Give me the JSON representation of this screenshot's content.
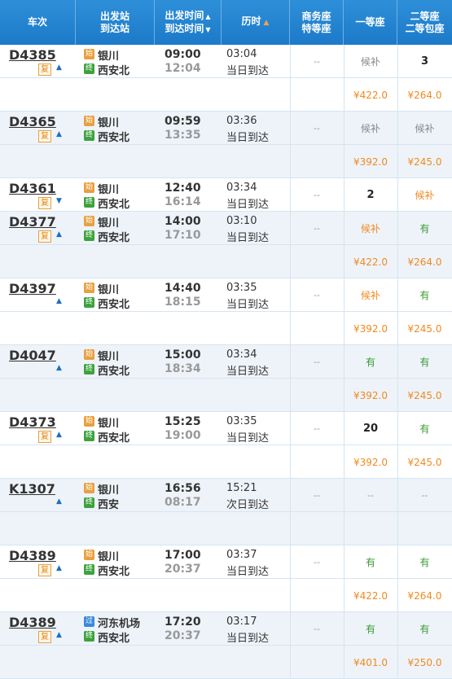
{
  "header": {
    "train": "车次",
    "from_station": "出发站",
    "to_station": "到达站",
    "dep_time": "出发时间",
    "arr_time": "到达时间",
    "duration": "历时",
    "business_1": "商务座",
    "business_2": "特等座",
    "first": "一等座",
    "second_1": "二等座",
    "second_2": "二等包座"
  },
  "trains": [
    {
      "no": "D4385",
      "fu": "复",
      "dir": "up",
      "from_badge": "始",
      "from": "银川",
      "to_badge": "终",
      "to": "西安北",
      "dep": "09:00",
      "arr": "12:04",
      "dur": "03:04",
      "day": "当日到达",
      "business": "--",
      "first": "候补",
      "first_c": "gray",
      "second": "3",
      "second_c": "num",
      "price_first": "¥422.0",
      "price_second": "¥264.0"
    },
    {
      "no": "D4365",
      "fu": "复",
      "dir": "up",
      "from_badge": "始",
      "from": "银川",
      "to_badge": "终",
      "to": "西安北",
      "dep": "09:59",
      "arr": "13:35",
      "dur": "03:36",
      "day": "当日到达",
      "business": "--",
      "first": "候补",
      "first_c": "gray",
      "second": "候补",
      "second_c": "gray",
      "price_first": "¥392.0",
      "price_second": "¥245.0"
    },
    {
      "no": "D4361",
      "fu": "复",
      "dir": "down",
      "from_badge": "始",
      "from": "银川",
      "to_badge": "终",
      "to": "西安北",
      "dep": "12:40",
      "arr": "16:14",
      "dur": "03:34",
      "day": "当日到达",
      "business": "--",
      "first": "2",
      "first_c": "num",
      "second": "候补",
      "second_c": "orange",
      "price_first": "",
      "price_second": ""
    },
    {
      "no": "D4377",
      "fu": "复",
      "dir": "up",
      "from_badge": "始",
      "from": "银川",
      "to_badge": "终",
      "to": "西安北",
      "dep": "14:00",
      "arr": "17:10",
      "dur": "03:10",
      "day": "当日到达",
      "business": "--",
      "first": "候补",
      "first_c": "orange",
      "second": "有",
      "second_c": "green",
      "price_first": "¥422.0",
      "price_second": "¥264.0"
    },
    {
      "no": "D4397",
      "fu": "",
      "dir": "up",
      "from_badge": "始",
      "from": "银川",
      "to_badge": "终",
      "to": "西安北",
      "dep": "14:40",
      "arr": "18:15",
      "dur": "03:35",
      "day": "当日到达",
      "business": "--",
      "first": "候补",
      "first_c": "orange",
      "second": "有",
      "second_c": "green",
      "price_first": "¥392.0",
      "price_second": "¥245.0"
    },
    {
      "no": "D4047",
      "fu": "",
      "dir": "up",
      "from_badge": "始",
      "from": "银川",
      "to_badge": "终",
      "to": "西安北",
      "dep": "15:00",
      "arr": "18:34",
      "dur": "03:34",
      "day": "当日到达",
      "business": "--",
      "first": "有",
      "first_c": "green",
      "second": "有",
      "second_c": "green",
      "price_first": "¥392.0",
      "price_second": "¥245.0"
    },
    {
      "no": "D4373",
      "fu": "复",
      "dir": "up",
      "from_badge": "始",
      "from": "银川",
      "to_badge": "终",
      "to": "西安北",
      "dep": "15:25",
      "arr": "19:00",
      "dur": "03:35",
      "day": "当日到达",
      "business": "--",
      "first": "20",
      "first_c": "num",
      "second": "有",
      "second_c": "green",
      "price_first": "¥392.0",
      "price_second": "¥245.0"
    },
    {
      "no": "K1307",
      "fu": "",
      "dir": "up",
      "from_badge": "始",
      "from": "银川",
      "to_badge": "终",
      "to": "西安",
      "dep": "16:56",
      "arr": "08:17",
      "dur": "15:21",
      "day": "次日到达",
      "business": "--",
      "first": "--",
      "first_c": "dash",
      "second": "--",
      "second_c": "dash",
      "price_first": "",
      "price_second": ""
    },
    {
      "no": "D4389",
      "fu": "复",
      "dir": "up",
      "from_badge": "始",
      "from": "银川",
      "to_badge": "终",
      "to": "西安北",
      "dep": "17:00",
      "arr": "20:37",
      "dur": "03:37",
      "day": "当日到达",
      "business": "--",
      "first": "有",
      "first_c": "green",
      "second": "有",
      "second_c": "green",
      "price_first": "¥422.0",
      "price_second": "¥264.0"
    },
    {
      "no": "D4389",
      "fu": "复",
      "dir": "up",
      "from_badge": "过",
      "from": "河东机场",
      "to_badge": "终",
      "to": "西安北",
      "dep": "17:20",
      "arr": "20:37",
      "dur": "03:17",
      "day": "当日到达",
      "business": "--",
      "first": "有",
      "first_c": "green",
      "second": "有",
      "second_c": "green",
      "price_first": "¥401.0",
      "price_second": "¥250.0"
    }
  ],
  "layout_rows": [
    "t0",
    "p0",
    "t1",
    "p1",
    "t2",
    "t3",
    "p3",
    "t4",
    "p4",
    "t5",
    "p5",
    "t6",
    "p6",
    "t7",
    "p7",
    "t8",
    "p8",
    "t9",
    "p9"
  ]
}
